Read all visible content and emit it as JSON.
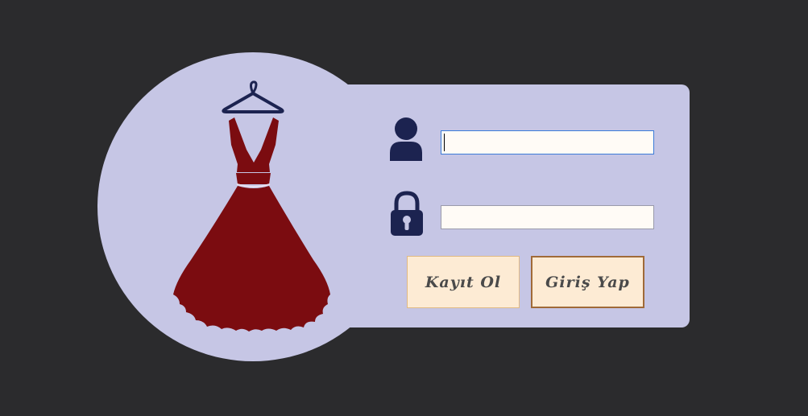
{
  "colors": {
    "background": "#2b2b2d",
    "card": "#c6c6e5",
    "dress": "#7b0c10",
    "icon": "#1c2350",
    "button_fill": "#fdebd4"
  },
  "icons": {
    "hero": "dress-on-hanger-icon",
    "username": "user-icon",
    "password": "lock-icon"
  },
  "form": {
    "username_value": "",
    "password_value": ""
  },
  "buttons": {
    "register_label": "Kayıt Ol",
    "login_label": "Giriş Yap"
  }
}
